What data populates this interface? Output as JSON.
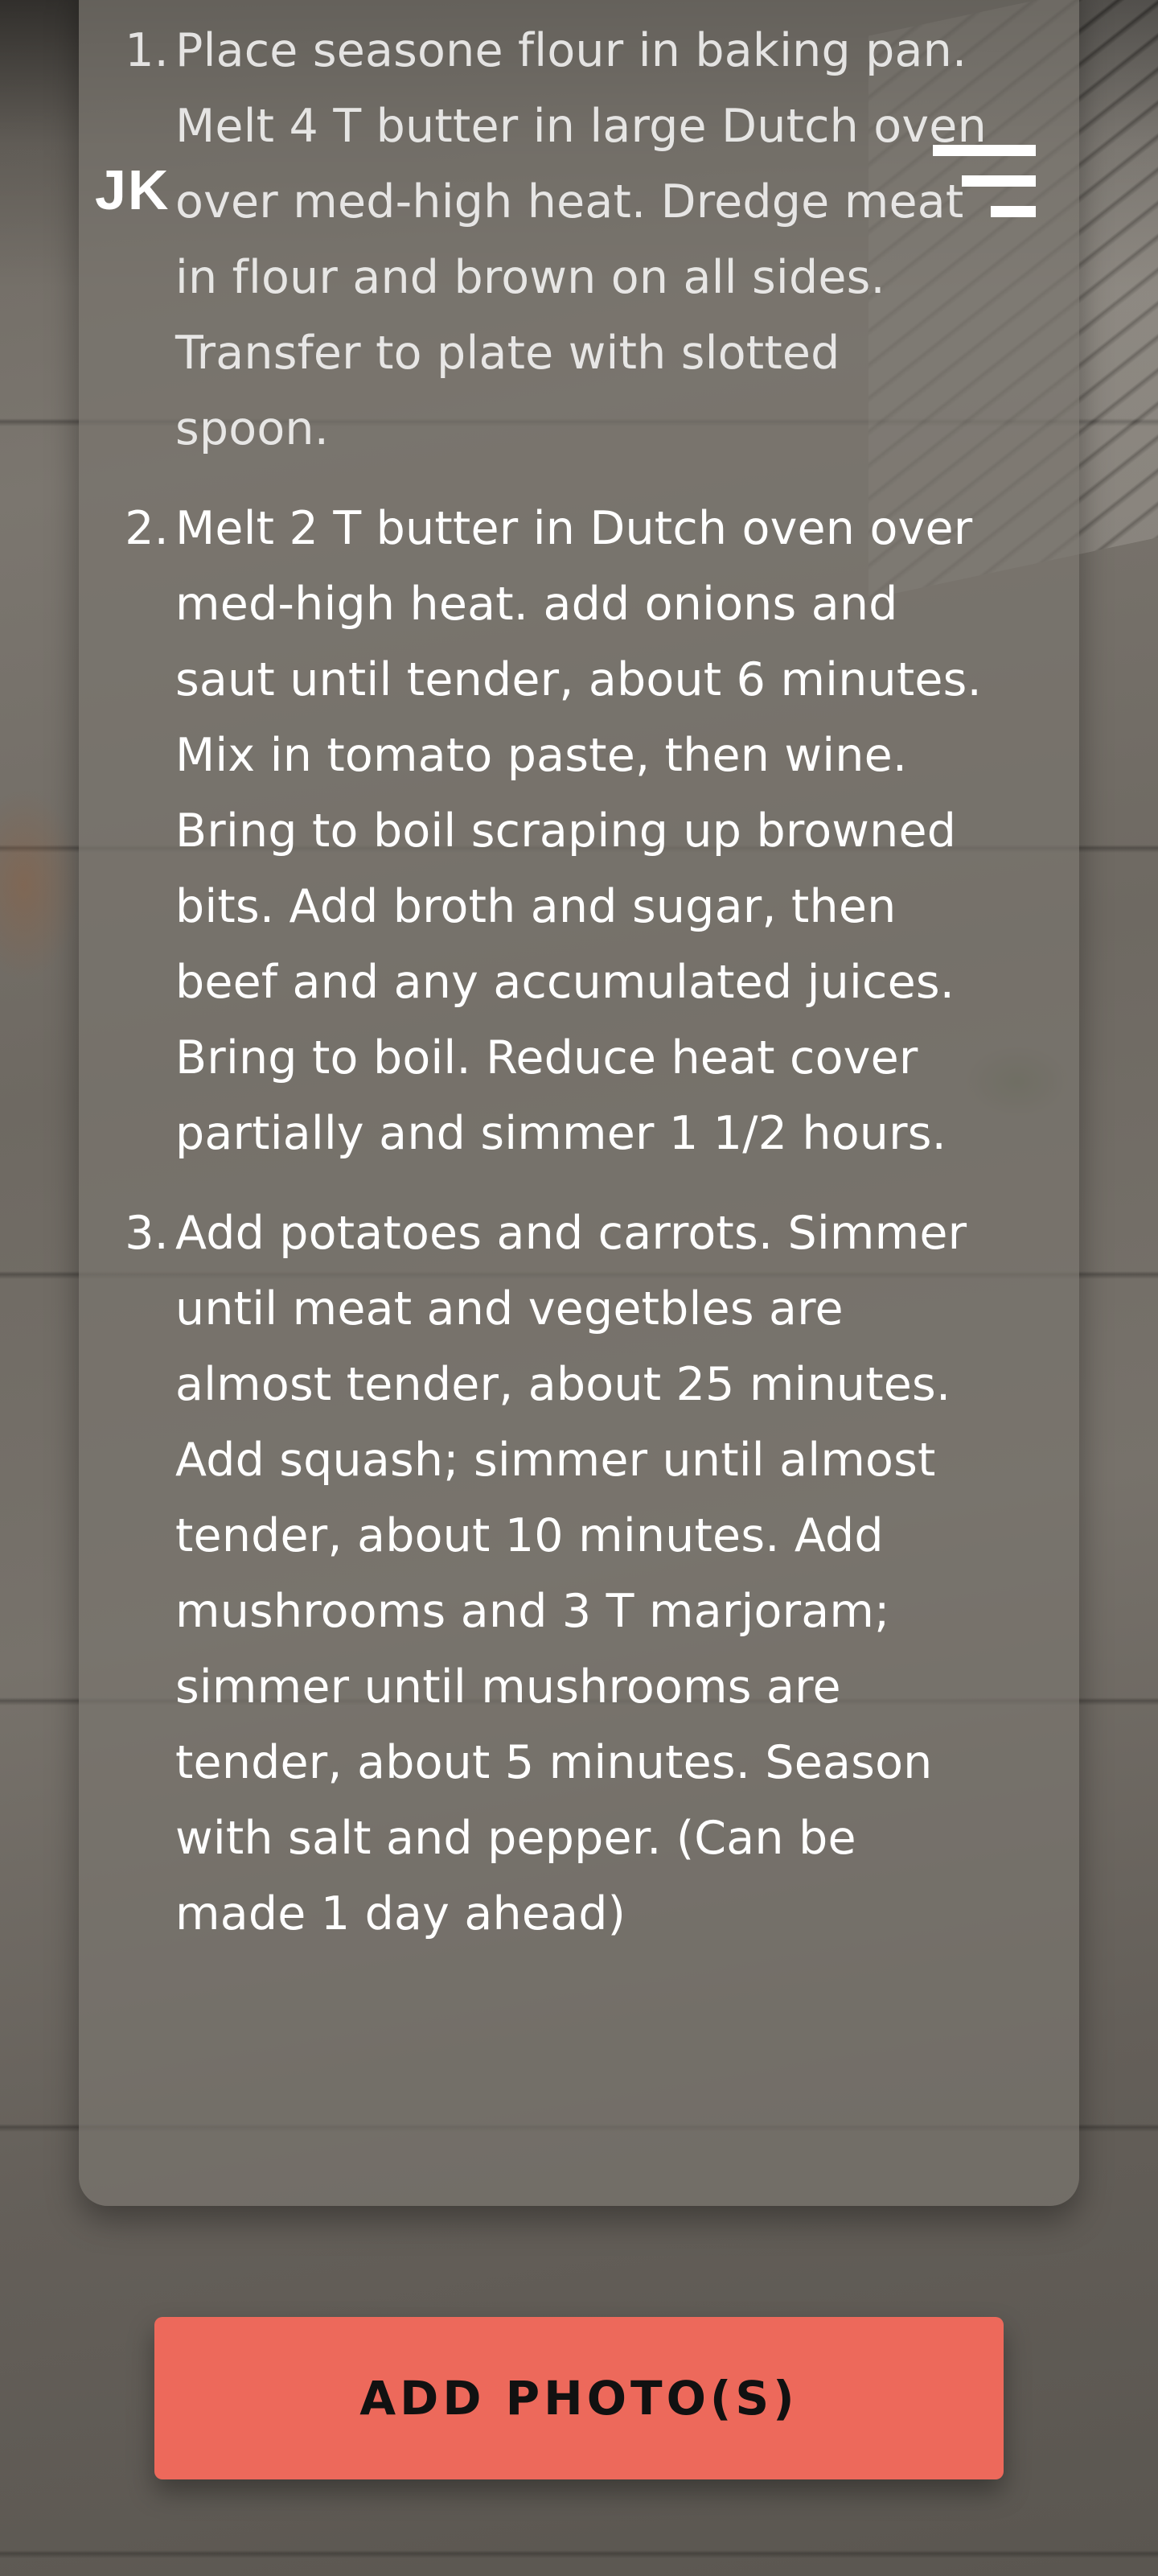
{
  "header": {
    "logo_text": "JK",
    "menu_icon": "hamburger-menu-icon"
  },
  "instructions": {
    "steps": [
      {
        "number": "1.",
        "text": "Place seasone flour in baking pan. Melt 4 T butter in large Dutch oven over med-high heat. Dredge meat in flour and brown on all sides. Transfer to plate with slotted spoon."
      },
      {
        "number": "2.",
        "text": "Melt 2 T butter in Dutch oven over med-high heat. add onions and saut until tender, about 6 minutes. Mix in tomato paste, then wine. Bring to boil scraping up browned bits. Add broth and sugar, then beef and any accumulated juices. Bring to boil. Reduce heat cover partially and simmer 1 1/2 hours."
      },
      {
        "number": "3.",
        "text": "Add potatoes and carrots. Simmer until meat and vegetbles are almost tender, about 25 minutes. Add squash; simmer until almost tender, about 10 minutes. Add mushrooms and 3 T marjoram; simmer until mushrooms are tender, about 5 minutes. Season with salt and pepper. (Can be made 1 day ahead)"
      }
    ]
  },
  "actions": {
    "add_photo_label": "ADD PHOTO(S)",
    "add_photo_color": "#ed695b"
  }
}
